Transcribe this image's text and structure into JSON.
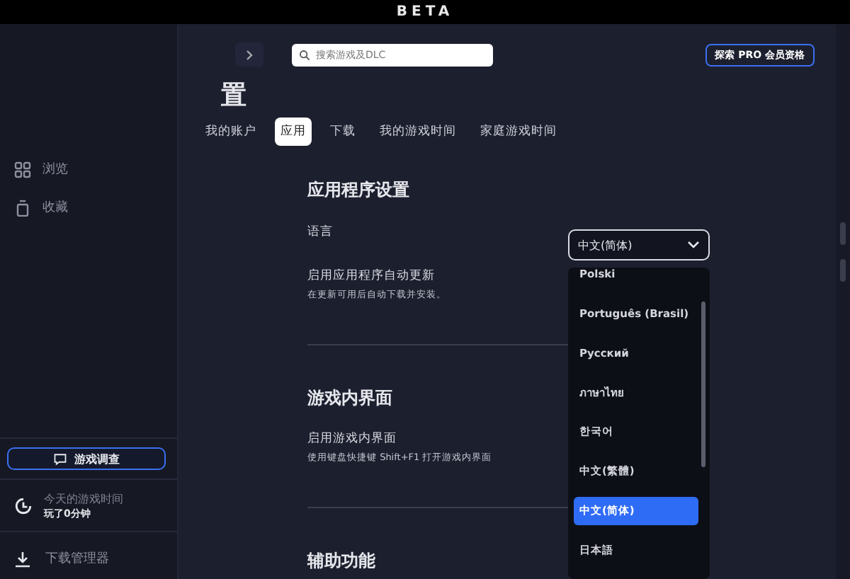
{
  "window": {
    "title": "BETA"
  },
  "sidebar": {
    "items": [
      {
        "label": "浏览"
      },
      {
        "label": "收藏"
      }
    ],
    "survey_button": "游戏调查",
    "playtime": {
      "title": "今天的游戏时间",
      "value": "玩了0分钟"
    },
    "downloads": "下载管理器"
  },
  "toolbar": {
    "search": {
      "placeholder": "搜索游戏及DLC"
    },
    "pro_button": "探索 PRO 会员资格"
  },
  "page_title": "置",
  "tabs": [
    {
      "label": "我的账户",
      "selected": false
    },
    {
      "label": "应用",
      "selected": true
    },
    {
      "label": "下载",
      "selected": false
    },
    {
      "label": "我的游戏时间",
      "selected": false
    },
    {
      "label": "家庭游戏时间",
      "selected": false
    }
  ],
  "sections": [
    {
      "heading": "应用程序设置",
      "settings": [
        {
          "label": "语言",
          "value": "中文(简体)"
        },
        {
          "label": "启用应用程序自动更新",
          "description": "在更新可用后自动下载并安装。"
        }
      ]
    },
    {
      "heading": "游戏内界面",
      "settings": [
        {
          "label": "启用游戏内界面",
          "description": "使用键盘快捷键 Shift+F1 打开游戏内界面"
        }
      ]
    },
    {
      "heading": "辅助功能"
    }
  ],
  "language_menu": {
    "options": [
      {
        "label": "Polski",
        "selected": false
      },
      {
        "label": "Português (Brasil)",
        "selected": false
      },
      {
        "label": "Русский",
        "selected": false
      },
      {
        "label": "ภาษาไทย",
        "selected": false
      },
      {
        "label": "한국어",
        "selected": false
      },
      {
        "label": "中文(繁體)",
        "selected": false
      },
      {
        "label": "中文(简体)",
        "selected": true
      },
      {
        "label": "日本語",
        "selected": false
      }
    ]
  }
}
